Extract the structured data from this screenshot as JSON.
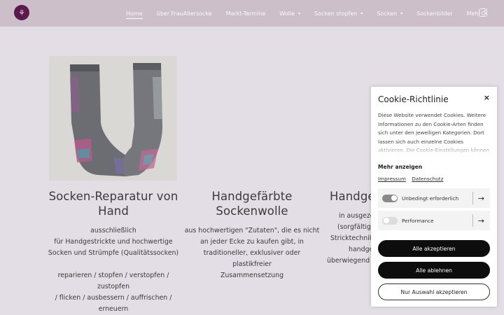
{
  "nav": {
    "logo_glyph": "⚘",
    "items": [
      {
        "label": "Home",
        "dropdown": false
      },
      {
        "label": "über FrauAllersocke",
        "dropdown": false
      },
      {
        "label": "Markt-Termine",
        "dropdown": false
      },
      {
        "label": "Wolle",
        "dropdown": true
      },
      {
        "label": "Socken stopfen",
        "dropdown": true
      },
      {
        "label": "Socken",
        "dropdown": true
      },
      {
        "label": "Sockenbilder",
        "dropdown": false
      },
      {
        "label": "Mehr",
        "dropdown": true
      }
    ],
    "caret": "▾"
  },
  "sections": [
    {
      "title_lines": [
        "Socken-Reparatur von",
        "Hand"
      ],
      "text_lines": [
        "ausschließlich",
        "für Handgestrickte und hochwertige",
        "Socken und Strümpfe (Qualitätssocken)",
        "",
        "reparieren / stopfen / verstopfen / zustopfen",
        "/ flicken / ausbessern / auffrischen /",
        "erneuern"
      ]
    },
    {
      "title_lines": [
        "Handgefärbte",
        "Sockenwolle"
      ],
      "text_lines": [
        "aus hochwertigen \"Zutaten\", die es nicht",
        "an jeder Ecke zu kaufen gibt, in",
        "traditioneller,  exklusiver oder plastikfreier",
        "Zusammensetzung"
      ]
    },
    {
      "title_lines": [
        "Handge"
      ],
      "text_lines": [
        "in ausgezei",
        "(sorgfältige",
        "Stricktechnike",
        "handge",
        "überwiegend fü"
      ]
    }
  ],
  "cookie": {
    "title": "Cookie-Richtlinie",
    "close": "×",
    "text": "Diese Website verwendet Cookies. Weitere Informationen zu den Cookie-Arten finden sich unter den jeweiligen Kategorien. Dort lassen sich auch einzelne Cookies aktivieren. Die Cookie-Einstellungen können jederzeit über",
    "more": "Mehr anzeigen",
    "links": [
      "Impressum",
      "Datenschutz"
    ],
    "toggles": [
      {
        "label": "Unbedingt erforderlich",
        "on": true
      },
      {
        "label": "Performance",
        "on": false
      }
    ],
    "arrow": "→",
    "buttons": [
      "Alle akzeptieren",
      "Alle ablehnen",
      "Nur Auswahl akzeptieren"
    ]
  }
}
